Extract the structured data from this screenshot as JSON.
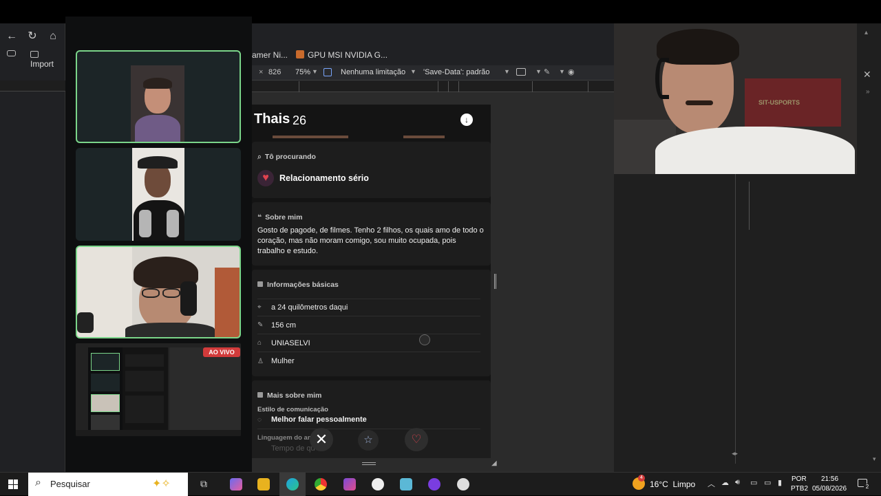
{
  "browser": {
    "left_bookmark": "Import",
    "bookmarks": [
      "amer Ni...",
      "GPU MSI NVIDIA G..."
    ],
    "devtools": {
      "width_value": "826",
      "zoom": "75%",
      "throttle": "Nenhuma limitação",
      "save_data": "'Save-Data': padrão"
    }
  },
  "call": {
    "live_badge": "AO VIVO"
  },
  "profile": {
    "name": "Thais",
    "age": "26",
    "looking_for_title": "Tô procurando",
    "looking_for_value": "Relacionamento sério",
    "about_title": "Sobre mim",
    "about_text": "Gosto de pagode, de filmes. Tenho 2 filhos, os quais amo de todo o coração, mas não moram comigo, sou muito ocupada, pois trabalho e estudo.",
    "basic_title": "Informações básicas",
    "basics": [
      {
        "icon": "location-pin-icon",
        "text": "a 24 quilômetros daqui"
      },
      {
        "icon": "ruler-icon",
        "text": "156 cm"
      },
      {
        "icon": "graduation-cap-icon",
        "text": "UNIASELVI"
      },
      {
        "icon": "person-icon",
        "text": "Mulher"
      }
    ],
    "more_title": "Mais sobre mim",
    "comm_style_label": "Estilo de comunicação",
    "comm_style_value": "Melhor falar pessoalmente",
    "love_lang_label": "Linguagem do am",
    "love_lang_value": "Tempo de qu        de"
  },
  "webcam": {
    "banner": "SIT-USPORTS"
  },
  "taskbar": {
    "search_placeholder": "Pesquisar",
    "weather_badge": "4",
    "weather": "16°C  Limpo",
    "lang_top": "POR",
    "lang_bottom": "PTB2",
    "time": "21:56",
    "date": "05/08/2026",
    "notif_count": "2"
  },
  "colors": {
    "accent_green": "#7bd68a",
    "live_red": "#d23b3b",
    "heart_red": "#e0434f"
  }
}
